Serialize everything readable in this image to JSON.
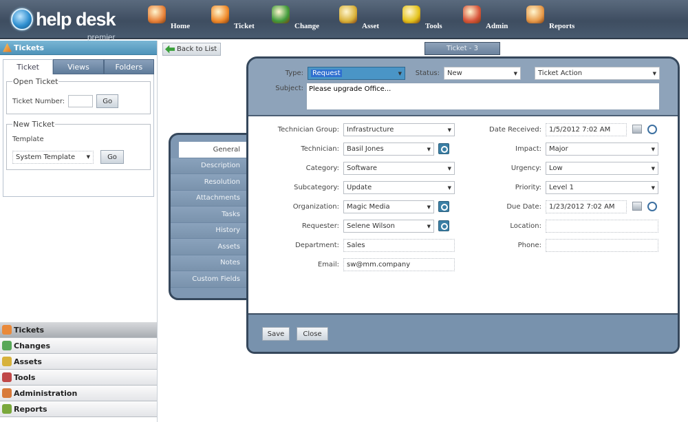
{
  "app": {
    "logo_text": "help desk",
    "logo_sub": "premier"
  },
  "nav": [
    {
      "label": "Home",
      "icon": "home-icon",
      "color": "#e8823a"
    },
    {
      "label": "Ticket",
      "icon": "ticket-icon",
      "color": "#f08a2a"
    },
    {
      "label": "Change",
      "icon": "change-icon",
      "color": "#3f9a3a"
    },
    {
      "label": "Asset",
      "icon": "asset-icon",
      "color": "#d9b23a"
    },
    {
      "label": "Tools",
      "icon": "tools-icon",
      "color": "#e3c21a"
    },
    {
      "label": "Admin",
      "icon": "admin-icon",
      "color": "#d8543a"
    },
    {
      "label": "Reports",
      "icon": "reports-icon",
      "color": "#e79a4a"
    }
  ],
  "left_panel": {
    "header": "Tickets",
    "tabs": [
      "Ticket",
      "Views",
      "Folders"
    ],
    "open_ticket": {
      "legend": "Open Ticket",
      "label": "Ticket Number:",
      "value": "",
      "button": "Go"
    },
    "new_ticket": {
      "legend": "New Ticket",
      "label": "Template",
      "template": "System Template",
      "button": "Go"
    },
    "accordion": [
      {
        "label": "Tickets",
        "icon": "tickets-icon",
        "color": "#e9893a",
        "active": true
      },
      {
        "label": "Changes",
        "icon": "changes-icon",
        "color": "#58a858"
      },
      {
        "label": "Assets",
        "icon": "assets-icon",
        "color": "#d7b23c"
      },
      {
        "label": "Tools",
        "icon": "tools-icon",
        "color": "#c04848"
      },
      {
        "label": "Administration",
        "icon": "administration-icon",
        "color": "#d87a3a"
      },
      {
        "label": "Reports",
        "icon": "reports-icon",
        "color": "#7aa83c"
      }
    ]
  },
  "main": {
    "back_button": "Back to List",
    "ticket_tab": "Ticket - 3",
    "header": {
      "type_label": "Type:",
      "type_value": "Request",
      "status_label": "Status:",
      "status_value": "New",
      "action_value": "Ticket Action",
      "subject_label": "Subject:",
      "subject_value": "Please upgrade Office..."
    },
    "side_tabs": [
      "General",
      "Description",
      "Resolution",
      "Attachments",
      "Tasks",
      "History",
      "Assets",
      "Notes",
      "Custom Fields"
    ],
    "left_fields": [
      {
        "label": "Technician Group:",
        "value": "Infrastructure",
        "kind": "select"
      },
      {
        "label": "Technician:",
        "value": "Basil Jones",
        "kind": "select-search"
      },
      {
        "label": "Category:",
        "value": "Software",
        "kind": "select"
      },
      {
        "label": "Subcategory:",
        "value": "Update",
        "kind": "select"
      },
      {
        "label": "Organization:",
        "value": "Magic Media",
        "kind": "select-search"
      },
      {
        "label": "Requester:",
        "value": "Selene Wilson",
        "kind": "select-search"
      },
      {
        "label": "Department:",
        "value": "Sales",
        "kind": "text"
      },
      {
        "label": "Email:",
        "value": "sw@mm.company",
        "kind": "text"
      }
    ],
    "right_fields": [
      {
        "label": "Date Received:",
        "value": "1/5/2012 7:02 AM",
        "kind": "datetime"
      },
      {
        "label": "Impact:",
        "value": "Major",
        "kind": "select"
      },
      {
        "label": "Urgency:",
        "value": "Low",
        "kind": "select"
      },
      {
        "label": "Priority:",
        "value": "Level 1",
        "kind": "select"
      },
      {
        "label": "Due Date:",
        "value": "1/23/2012 7:02 AM",
        "kind": "datetime"
      },
      {
        "label": "Location:",
        "value": "",
        "kind": "text"
      },
      {
        "label": "Phone:",
        "value": "",
        "kind": "text"
      }
    ],
    "footer": {
      "save": "Save",
      "close": "Close"
    }
  }
}
